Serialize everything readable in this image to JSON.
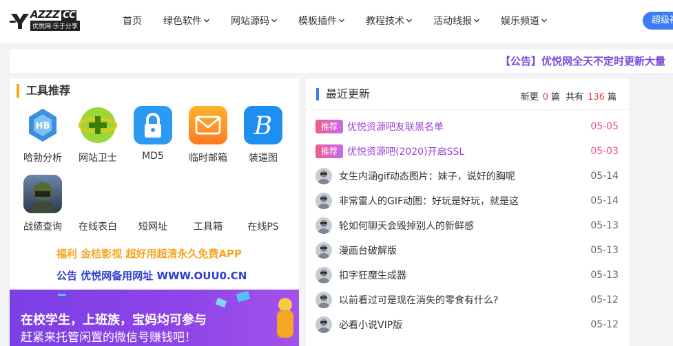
{
  "header": {
    "logo_text": "AZZZ",
    "logo_cc": "CC",
    "logo_sub": "优悦网·乐于分享",
    "nav": [
      {
        "label": "首页",
        "dropdown": false
      },
      {
        "label": "绿色软件",
        "dropdown": true
      },
      {
        "label": "网站源码",
        "dropdown": true
      },
      {
        "label": "模板插件",
        "dropdown": true
      },
      {
        "label": "教程技术",
        "dropdown": true
      },
      {
        "label": "活动线报",
        "dropdown": true
      },
      {
        "label": "娱乐频道",
        "dropdown": true
      }
    ],
    "vip_button": "超级视"
  },
  "notice": {
    "text": "【公告】优悦网全天不定时更新大量"
  },
  "tools": {
    "title": "工具推荐",
    "items": [
      {
        "label": "哈勃分析",
        "icon": "hubble-icon"
      },
      {
        "label": "网站卫士",
        "icon": "shield-plus-icon"
      },
      {
        "label": "MD5",
        "icon": "lock-icon"
      },
      {
        "label": "临时邮箱",
        "icon": "mail-icon"
      },
      {
        "label": "装逼图",
        "icon": "b-letter-icon"
      },
      {
        "label": "战绩查询",
        "icon": "game-avatar-icon"
      },
      {
        "label": "在线表白",
        "icon": ""
      },
      {
        "label": "短网址",
        "icon": ""
      },
      {
        "label": "工具箱",
        "icon": ""
      },
      {
        "label": "在线PS",
        "icon": ""
      }
    ],
    "promo1": "福利 金桔影视 超好用超清永久免费APP",
    "promo2": "公告 优悦网备用网址 WWW.OUU0.CN",
    "banner_line1": "在校学生，上班族，宝妈均可参与",
    "banner_line2": "赶紧来托管闲置的微信号赚钱吧！"
  },
  "latest": {
    "title": "最近更新",
    "stats": {
      "new_label": "新更",
      "new_count": "0",
      "unit1": "篇",
      "total_label": "共有",
      "total_count": "136",
      "unit2": "篇"
    },
    "items": [
      {
        "tag": "推荐",
        "title": "优悦资源吧友联黑名单",
        "date": "05-05",
        "hot": true
      },
      {
        "tag": "推荐",
        "title": "优悦资源吧(2020)开启SSL",
        "date": "05-03",
        "hot": true
      },
      {
        "tag": "",
        "title": "女生内涵gif动态图片：妹子，说好的胸呢",
        "date": "05-14",
        "hot": false
      },
      {
        "tag": "",
        "title": "非常雷人的GIF动图：好玩是好玩，就是这",
        "date": "05-14",
        "hot": false
      },
      {
        "tag": "",
        "title": "轮如何聊天会毁掉别人的新鲜感",
        "date": "05-13",
        "hot": false
      },
      {
        "tag": "",
        "title": "漫画台破解版",
        "date": "05-13",
        "hot": false
      },
      {
        "tag": "",
        "title": "扣字狂魔生成器",
        "date": "05-13",
        "hot": false
      },
      {
        "tag": "",
        "title": "以前看过可是现在消失的零食有什么?",
        "date": "05-12",
        "hot": false
      },
      {
        "tag": "",
        "title": "必看小说VIP版",
        "date": "05-12",
        "hot": false
      }
    ]
  },
  "colors": {
    "accent": "#3e7cf6",
    "orange": "#f5a623",
    "purple": "#7a4dde",
    "pink": "#ec4d8b",
    "red": "#e8443a"
  }
}
